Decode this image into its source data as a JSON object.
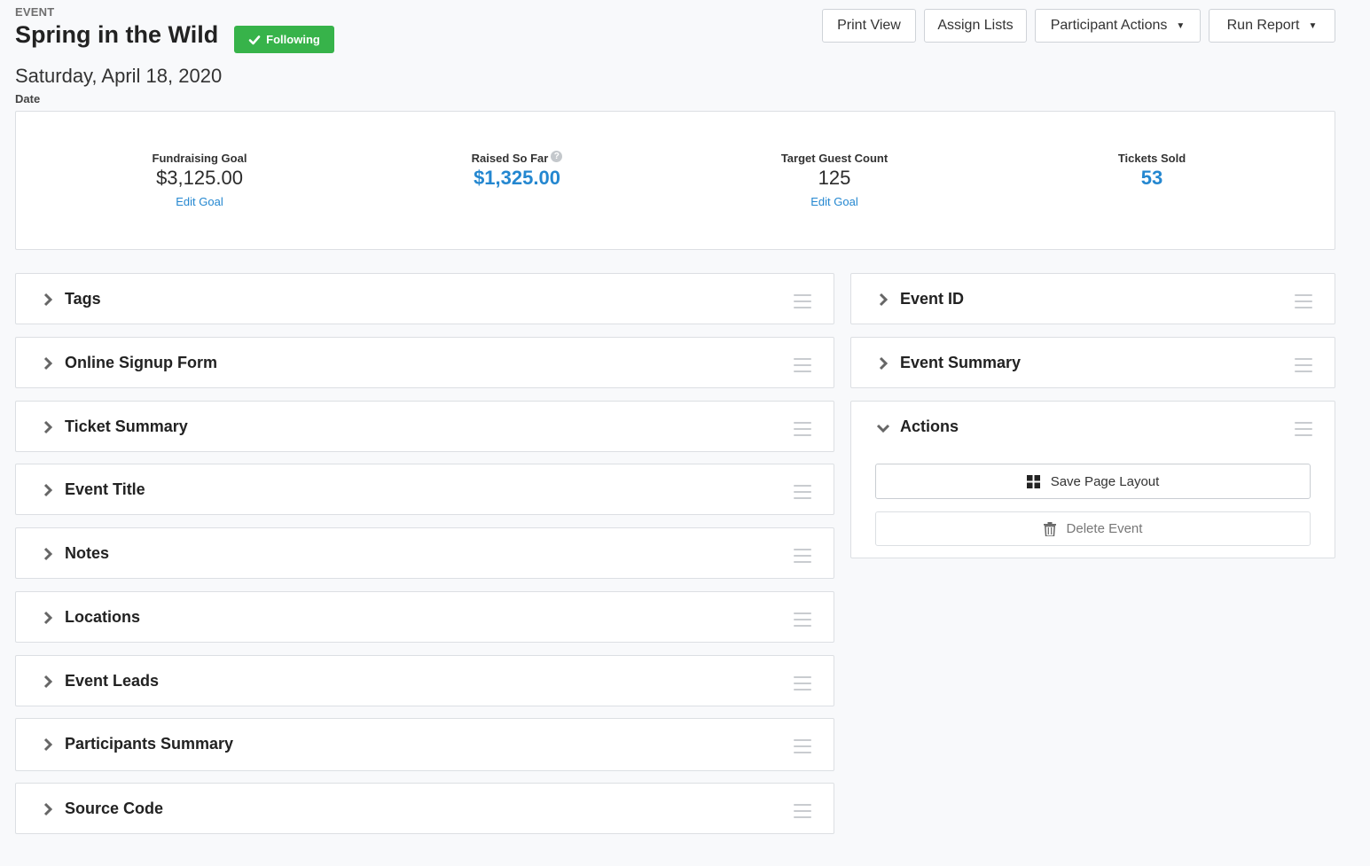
{
  "header": {
    "eyebrow": "EVENT",
    "title": "Spring in the Wild",
    "badge": "Following",
    "date_value": "Saturday, April 18, 2020",
    "date_label": "Date"
  },
  "toolbar": {
    "print_view": "Print View",
    "assign_lists": "Assign Lists",
    "participant_actions": "Participant Actions",
    "run_report": "Run Report"
  },
  "goals": [
    {
      "label": "Fundraising Goal",
      "value": "$3,125.00",
      "link": "Edit Goal"
    },
    {
      "label": "Raised So Far",
      "value": "$1,325.00",
      "help_icon": "?"
    },
    {
      "label": "Target Guest Count",
      "value": "125",
      "link": "Edit Goal"
    },
    {
      "label": "Tickets Sold",
      "value": "53"
    }
  ],
  "left_panels": [
    "Tags",
    "Online Signup Form",
    "Ticket Summary",
    "Event Title",
    "Notes",
    "Locations",
    "Event Leads",
    "Participants Summary",
    "Source Code"
  ],
  "right_panels": [
    "Event ID",
    "Event Summary"
  ],
  "actions_panel": {
    "title": "Actions",
    "save_layout": "Save Page Layout",
    "delete_event": "Delete Event"
  },
  "colors": {
    "accent_blue": "#2487d0",
    "badge_green": "#37b34a",
    "background": "#f8f9fb"
  }
}
